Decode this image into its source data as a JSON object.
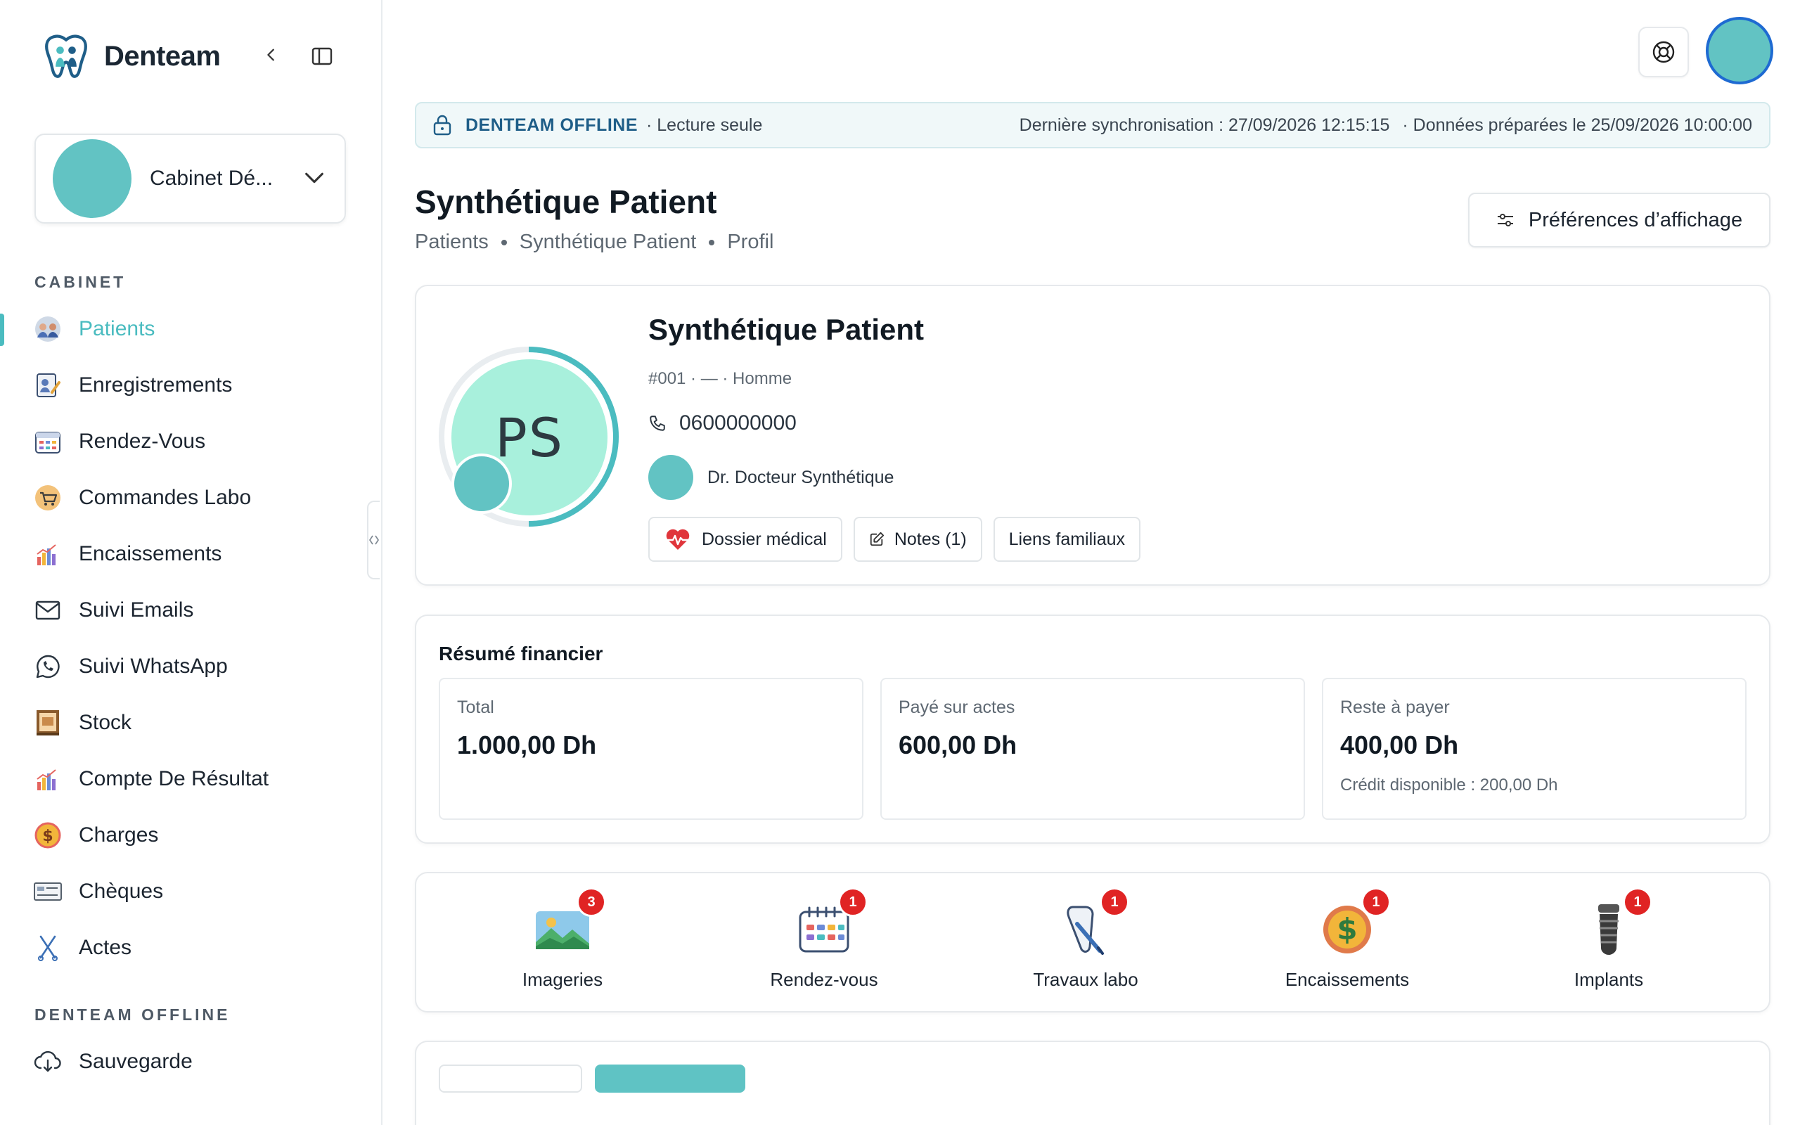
{
  "app": {
    "brand": "Denteam",
    "org_name": "Cabinet Dé..."
  },
  "sidebar": {
    "section_cabinet": "CABINET",
    "items": [
      {
        "label": "Patients",
        "icon": "patients-icon",
        "active": true
      },
      {
        "label": "Enregistrements",
        "icon": "records-icon"
      },
      {
        "label": "Rendez-Vous",
        "icon": "calendar-icon"
      },
      {
        "label": "Commandes Labo",
        "icon": "lab-cart-icon"
      },
      {
        "label": "Encaissements",
        "icon": "bar-chart-icon"
      },
      {
        "label": "Suivi Emails",
        "icon": "mail-icon"
      },
      {
        "label": "Suivi WhatsApp",
        "icon": "whatsapp-icon"
      },
      {
        "label": "Stock",
        "icon": "stock-icon"
      },
      {
        "label": "Compte De Résultat",
        "icon": "bar-chart-icon"
      },
      {
        "label": "Charges",
        "icon": "dollar-icon"
      },
      {
        "label": "Chèques",
        "icon": "cheque-icon"
      },
      {
        "label": "Actes",
        "icon": "scissors-icon"
      }
    ],
    "section_offline": "DENTEAM OFFLINE",
    "offline_items": [
      {
        "label": "Sauvegarde",
        "icon": "cloud-download-icon"
      }
    ]
  },
  "banner": {
    "title": "DENTEAM OFFLINE",
    "mode": "· Lecture seule",
    "last_sync": "Dernière synchronisation : 27/09/2026 12:15:15",
    "prepared": "· Données préparées le 25/09/2026 10:00:00"
  },
  "page": {
    "title": "Synthétique Patient",
    "breadcrumb": [
      "Patients",
      "Synthétique Patient",
      "Profil"
    ],
    "pref_button": "Préférences d’affichage"
  },
  "patient": {
    "initials": "PS",
    "name": "Synthétique Patient",
    "meta": "#001 · — · Homme",
    "phone": "0600000000",
    "doctor": "Dr. Docteur Synthétique",
    "buttons": {
      "medical": "Dossier médical",
      "notes": "Notes (1)",
      "family": "Liens familiaux"
    }
  },
  "finance": {
    "title": "Résumé financier",
    "total_label": "Total",
    "total_value": "1.000,00 Dh",
    "paid_label": "Payé sur actes",
    "paid_value": "600,00 Dh",
    "rest_label": "Reste à payer",
    "rest_value": "400,00 Dh",
    "credit": "Crédit disponible : 200,00 Dh"
  },
  "quick": [
    {
      "label": "Imageries",
      "count": "3",
      "icon": "image-icon"
    },
    {
      "label": "Rendez-vous",
      "count": "1",
      "icon": "calendar-icon"
    },
    {
      "label": "Travaux labo",
      "count": "1",
      "icon": "tooth-brush-icon"
    },
    {
      "label": "Encaissements",
      "count": "1",
      "icon": "dollar-icon"
    },
    {
      "label": "Implants",
      "count": "1",
      "icon": "implant-icon"
    }
  ],
  "colors": {
    "accent": "#4bbcc0",
    "avatar": "#62c3c3",
    "badge": "#e02424",
    "banner_title": "#1f5e88"
  }
}
